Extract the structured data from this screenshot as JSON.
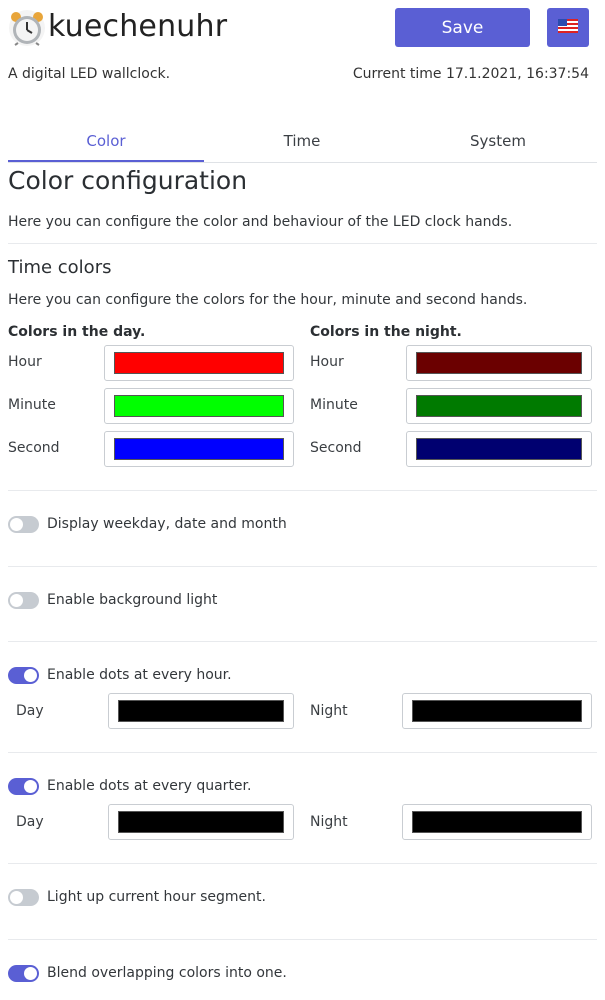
{
  "header": {
    "app_title": "kuechenuhr",
    "app_icon": "alarm-clock-icon",
    "save_label": "Save",
    "language_flag": "us-flag-icon",
    "subtitle": "A digital LED wallclock.",
    "current_time": "Current time 17.1.2021, 16:37:54"
  },
  "tabs": [
    {
      "label": "Color",
      "active": true
    },
    {
      "label": "Time",
      "active": false
    },
    {
      "label": "System",
      "active": false
    }
  ],
  "main": {
    "title": "Color configuration",
    "description": "Here you can configure the color and behaviour of the LED clock hands.",
    "time_colors": {
      "title": "Time colors",
      "description": "Here you can configure the colors for the hour, minute and second hands.",
      "day_heading": "Colors in the day.",
      "night_heading": "Colors in the night.",
      "day": [
        {
          "label": "Hour",
          "color": "#ff0000"
        },
        {
          "label": "Minute",
          "color": "#00ff00"
        },
        {
          "label": "Second",
          "color": "#0000ff"
        }
      ],
      "night": [
        {
          "label": "Hour",
          "color": "#6b0000"
        },
        {
          "label": "Minute",
          "color": "#007a00"
        },
        {
          "label": "Second",
          "color": "#000070"
        }
      ]
    },
    "options": {
      "weekday": {
        "label": "Display weekday, date and month",
        "enabled": false
      },
      "background": {
        "label": "Enable background light",
        "enabled": false
      },
      "hour_dots": {
        "label": "Enable dots at every hour.",
        "enabled": true,
        "day_label": "Day",
        "day_color": "#000000",
        "night_label": "Night",
        "night_color": "#000000"
      },
      "quarter_dots": {
        "label": "Enable dots at every quarter.",
        "enabled": true,
        "day_label": "Day",
        "day_color": "#000000",
        "night_label": "Night",
        "night_color": "#000000"
      },
      "hour_segment": {
        "label": "Light up current hour segment.",
        "enabled": false
      },
      "blend": {
        "label": "Blend overlapping colors into one.",
        "enabled": true
      }
    }
  },
  "theme": {
    "accent": "#5a5fd4",
    "toggle_off": "#c6cbd1"
  }
}
